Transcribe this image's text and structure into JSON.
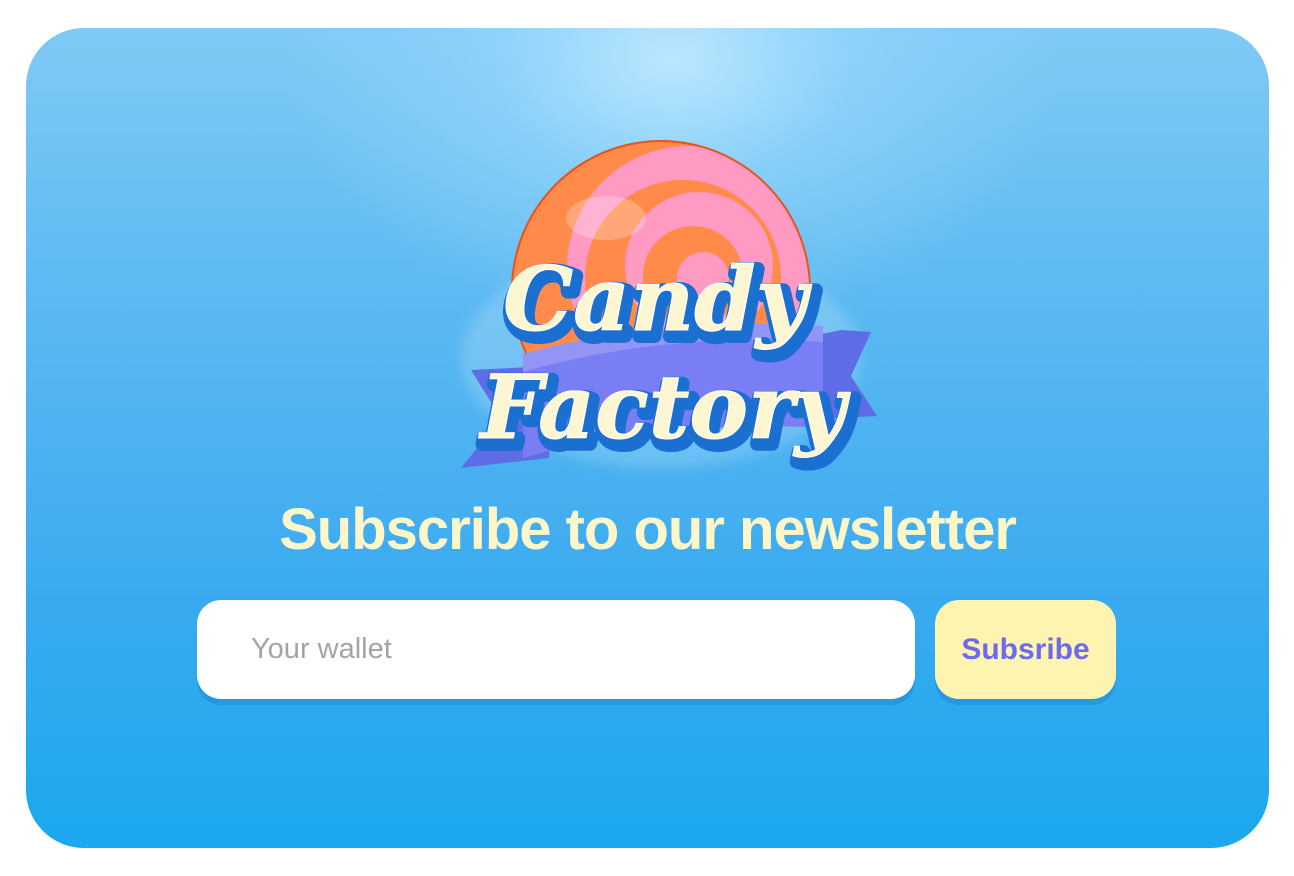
{
  "logo": {
    "line1": "Candy",
    "line2": "Factory"
  },
  "newsletter": {
    "title": "Subscribe to our newsletter",
    "input_placeholder": "Your wallet",
    "input_value": "",
    "button_label": "Subsribe"
  },
  "colors": {
    "background_top": "#9edcfb",
    "background_bottom": "#1aa8ee",
    "title": "#fdf6c9",
    "button_bg": "#fdf4b0",
    "button_text": "#6f69ee",
    "input_bg": "#ffffff",
    "placeholder": "#a4a4a4"
  }
}
